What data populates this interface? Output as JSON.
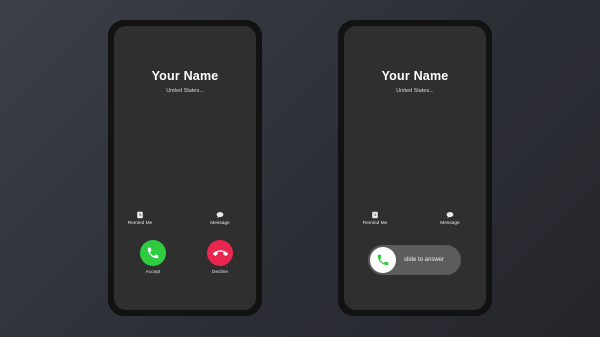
{
  "screens": [
    {
      "caller_name": "Your Name",
      "caller_location": "United States...",
      "remind_label": "Remind Me",
      "message_label": "Message",
      "accept_label": "Accept",
      "decline_label": "Decline"
    },
    {
      "caller_name": "Your Name",
      "caller_location": "United States...",
      "remind_label": "Remind Me",
      "message_label": "Message",
      "slide_label": "slide to answer"
    }
  ],
  "icons": {
    "remind": "alarm-clock-icon",
    "message": "chat-bubble-icon",
    "accept": "phone-icon",
    "decline": "phone-hangup-icon"
  },
  "colors": {
    "accept": "#2ecc40",
    "decline": "#e8264e",
    "slider_track": "#5c5c5c",
    "screen_bg": "#2f2f2f"
  }
}
